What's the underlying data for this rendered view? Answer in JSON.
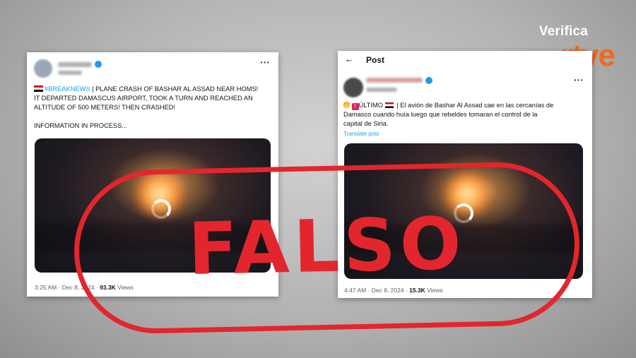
{
  "brand": {
    "top": "Verifica",
    "bottom": "rtve"
  },
  "left_post": {
    "hashtag": "#BREAKNEWS",
    "text_line1": " | PLANE CRASH OF BASHAR AL ASSAD NEAR HOMS!",
    "text_line2": "IT DEPARTED DAMASCUS AIRPORT, TOOK A TURN AND REACHED AN",
    "text_line3": "ALTITUDE OF 500 METERS! THEN CRASHED!",
    "text_line4": "INFORMATION IN PROCESS...",
    "timestamp": "3:25 AM · Dec 8, 2024 · ",
    "views_count": "93.3K",
    "views_label": " Views"
  },
  "right_post": {
    "header_title": "Post",
    "badge_label": "ÚLTIMO",
    "text_line1": " | El avión de Bashar Al Assad cae en las cercanías de",
    "text_line2": "Damasco cuando huía luego que rebeldes tomaran el control de la",
    "text_line3": "capital de Siria.",
    "translate": "Translate post",
    "timestamp": "4:47 AM · Dec 8, 2024 · ",
    "views_count": "15.3K",
    "views_label": " Views"
  },
  "stamp": {
    "label": "FALSO"
  },
  "colors": {
    "stamp": "#e3262d",
    "brand": "#f26a1b",
    "link": "#1d9bf0"
  },
  "icons": [
    "more-icon",
    "back-arrow-icon",
    "verified-icon",
    "loading-spinner-icon",
    "fire-emoji-icon",
    "syria-flag-icon"
  ]
}
